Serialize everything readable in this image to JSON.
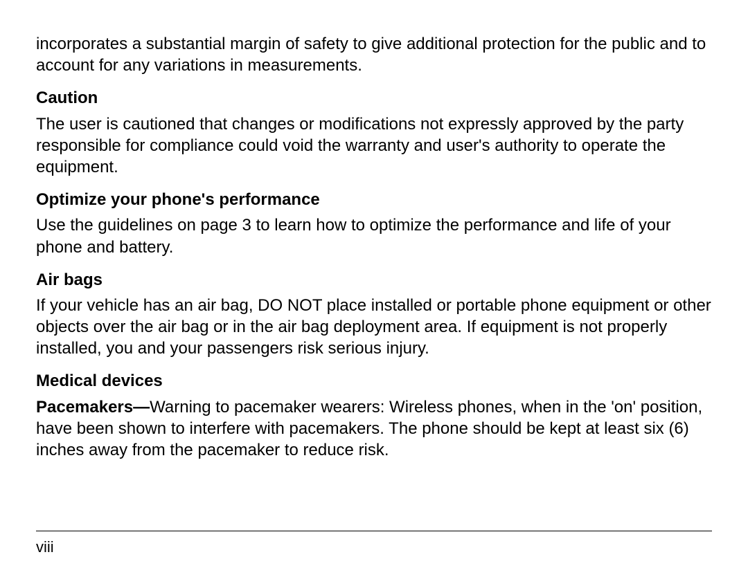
{
  "sections": {
    "intro": "incorporates a substantial margin of safety to give additional protection for the public and to account for any variations in measurements.",
    "caution_heading": "Caution",
    "caution_body": "The user is cautioned that changes or modifications not expressly approved by the party responsible for compliance could void the warranty and user's authority to operate the equipment.",
    "optimize_heading": "Optimize your phone's performance",
    "optimize_body": "Use the guidelines on page 3 to learn how to optimize the performance and life of your phone and battery.",
    "airbags_heading": "Air bags",
    "airbags_body": "If your vehicle has an air bag, DO NOT place installed or portable phone equipment or other objects over the air bag or in the air bag deployment area. If equipment is not properly installed, you and your passengers risk serious injury.",
    "medical_heading": "Medical devices",
    "pacemakers_label": "Pacemakers—",
    "pacemakers_body": "Warning to pacemaker wearers: Wireless phones, when in the 'on' position, have been shown to interfere with pacemakers. The phone should be kept at least six (6) inches away from the pacemaker to reduce risk."
  },
  "page_number": "viii"
}
